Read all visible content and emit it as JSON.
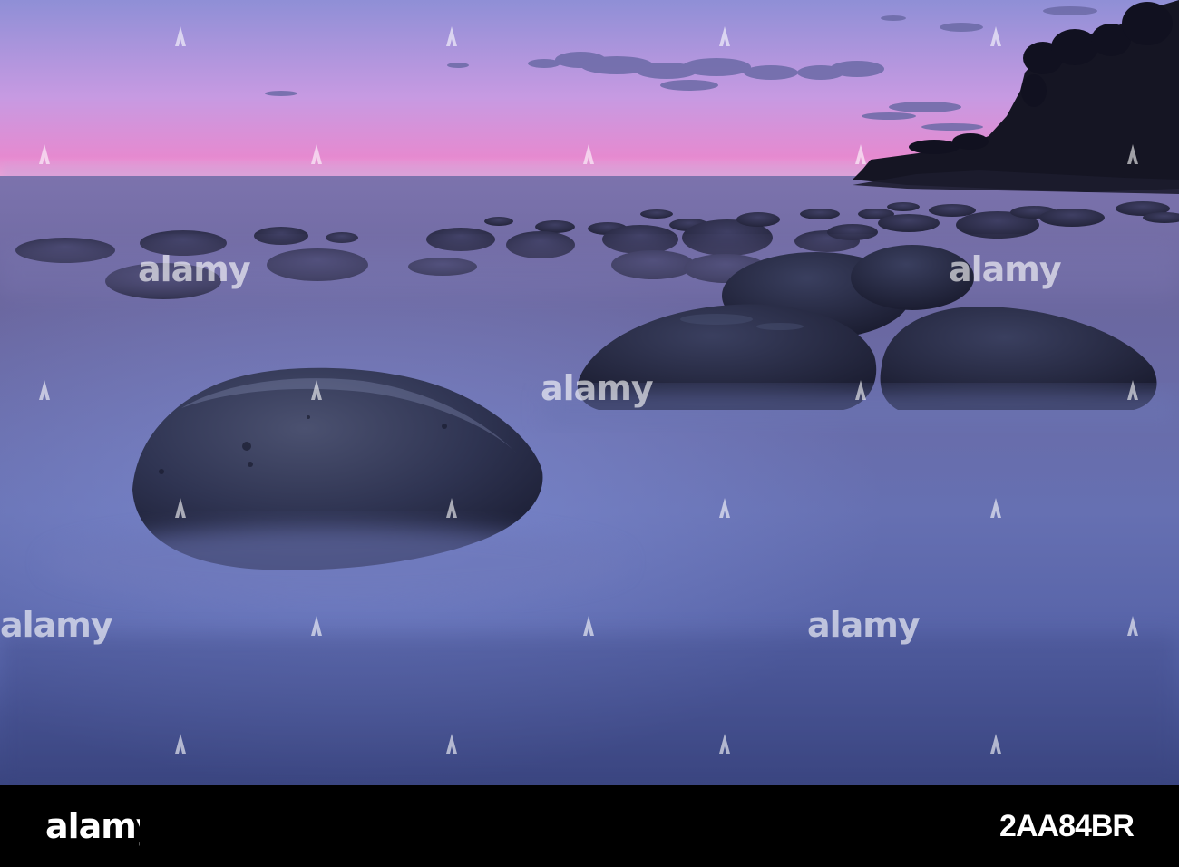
{
  "photo": {
    "subject": "Bowling Ball Beach",
    "colors": {
      "sky_top": "#8f8fd6",
      "sky_horizon": "#e58ad0",
      "water_top": "#6b679f",
      "water_bottom": "#3f4a86",
      "boulder": "#2b2f4a",
      "cliff": "#151523"
    }
  },
  "watermark": {
    "text": "alamy"
  },
  "footer": {
    "brand": "alamy",
    "image_id": "2AA84BR"
  }
}
